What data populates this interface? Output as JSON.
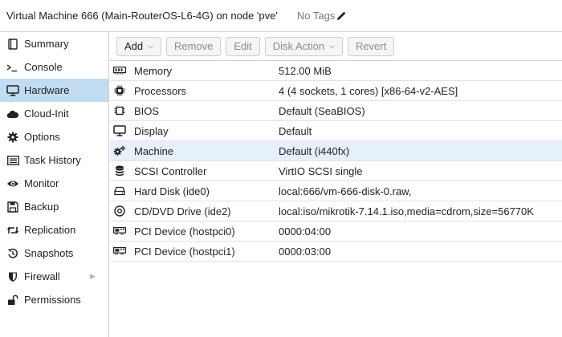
{
  "window": {
    "title": "Virtual Machine 666 (Main-RouterOS-L6-4G) on node 'pve'",
    "tags_label": "No Tags",
    "edit_icon": "pencil-icon"
  },
  "sidebar": {
    "items": [
      {
        "label": "Summary",
        "icon": "book-icon"
      },
      {
        "label": "Console",
        "icon": "terminal-icon"
      },
      {
        "label": "Hardware",
        "icon": "monitor-icon",
        "selected": true
      },
      {
        "label": "Cloud-Init",
        "icon": "cloud-icon"
      },
      {
        "label": "Options",
        "icon": "gear-icon"
      },
      {
        "label": "Task History",
        "icon": "list-icon"
      },
      {
        "label": "Monitor",
        "icon": "eye-icon"
      },
      {
        "label": "Backup",
        "icon": "floppy-icon"
      },
      {
        "label": "Replication",
        "icon": "retweet-icon"
      },
      {
        "label": "Snapshots",
        "icon": "history-icon"
      },
      {
        "label": "Firewall",
        "icon": "shield-icon",
        "has_submenu": true
      },
      {
        "label": "Permissions",
        "icon": "unlock-icon"
      }
    ],
    "selected_color": "#c2dcf1"
  },
  "toolbar": {
    "add_label": "Add",
    "remove_label": "Remove",
    "edit_label": "Edit",
    "disk_action_label": "Disk Action",
    "revert_label": "Revert"
  },
  "hardware": {
    "rows": [
      {
        "name": "Memory",
        "value": "512.00 MiB",
        "icon": "memory-icon"
      },
      {
        "name": "Processors",
        "value": "4 (4 sockets, 1 cores) [x86-64-v2-AES]",
        "icon": "cpu-icon"
      },
      {
        "name": "BIOS",
        "value": "Default (SeaBIOS)",
        "icon": "chip-icon"
      },
      {
        "name": "Display",
        "value": "Default",
        "icon": "desktop-icon"
      },
      {
        "name": "Machine",
        "value": "Default (i440fx)",
        "icon": "cogs-icon",
        "selected": true
      },
      {
        "name": "SCSI Controller",
        "value": "VirtIO SCSI single",
        "icon": "database-icon"
      },
      {
        "name": "Hard Disk (ide0)",
        "value": "local:666/vm-666-disk-0.raw,",
        "icon": "hdd-icon"
      },
      {
        "name": "CD/DVD Drive (ide2)",
        "value": "local:iso/mikrotik-7.14.1.iso,media=cdrom,size=56770K",
        "icon": "cdrom-icon"
      },
      {
        "name": "PCI Device (hostpci0)",
        "value": "0000:04:00",
        "icon": "pci-card-icon"
      },
      {
        "name": "PCI Device (hostpci1)",
        "value": "0000:03:00",
        "icon": "pci-card-icon"
      }
    ],
    "selected_color": "#e6f0fa"
  }
}
